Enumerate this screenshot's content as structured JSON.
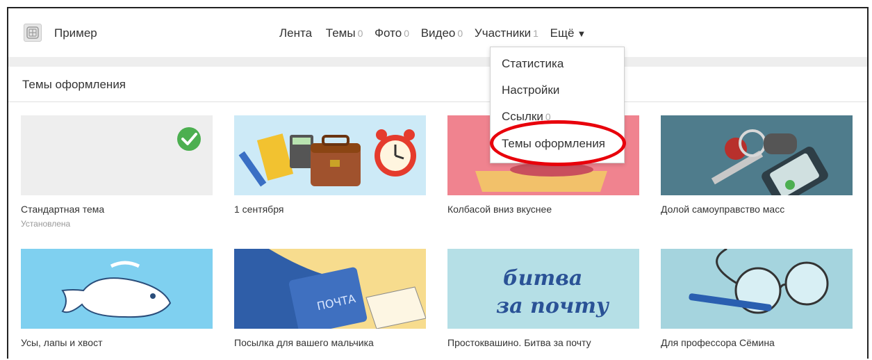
{
  "header": {
    "site_name": "Пример",
    "logo_icon": "group-avatar-icon"
  },
  "nav": {
    "items": [
      {
        "label": "Лента",
        "count": ""
      },
      {
        "label": "Темы",
        "count": "0"
      },
      {
        "label": "Фото",
        "count": "0"
      },
      {
        "label": "Видео",
        "count": "0"
      },
      {
        "label": "Участники",
        "count": "1"
      }
    ],
    "more_label": "Ещё",
    "more_icon": "triangle-down-icon"
  },
  "section": {
    "title": "Темы оформления"
  },
  "dropdown": {
    "items": [
      {
        "label": "Статистика",
        "count": ""
      },
      {
        "label": "Настройки",
        "count": ""
      },
      {
        "label": "Ссылки",
        "count": "0"
      },
      {
        "label": "Темы оформления",
        "count": ""
      }
    ],
    "highlight_color": "#e8000b"
  },
  "themes": [
    {
      "name": "Стандартная тема",
      "status": "Установлена",
      "bg": "#eeeeee"
    },
    {
      "name": "1 сентября",
      "status": "",
      "bg": "#cdeaf7"
    },
    {
      "name": "Колбасой вниз вкуснее",
      "status": "",
      "bg": "#f0838f"
    },
    {
      "name": "Долой самоуправство масс",
      "status": "",
      "bg": "#4f7c8c"
    },
    {
      "name": "Усы, лапы и хвост",
      "status": "",
      "bg": "#7fd0f0"
    },
    {
      "name": "Посылка для вашего мальчика",
      "status": "",
      "bg": "#f7dc8e"
    },
    {
      "name": "Простоквашино. Битва за почту",
      "status": "",
      "bg": "#b5dfe6"
    },
    {
      "name": "Для профессора Сёмина",
      "status": "",
      "bg": "#a5d4de"
    }
  ],
  "thumb_texts": {
    "mailbag": "ПОЧТА",
    "battle_line1": "битва",
    "battle_line2": "за почту"
  },
  "colors": {
    "check": "#4caf50",
    "accent_red": "#e8000b"
  }
}
